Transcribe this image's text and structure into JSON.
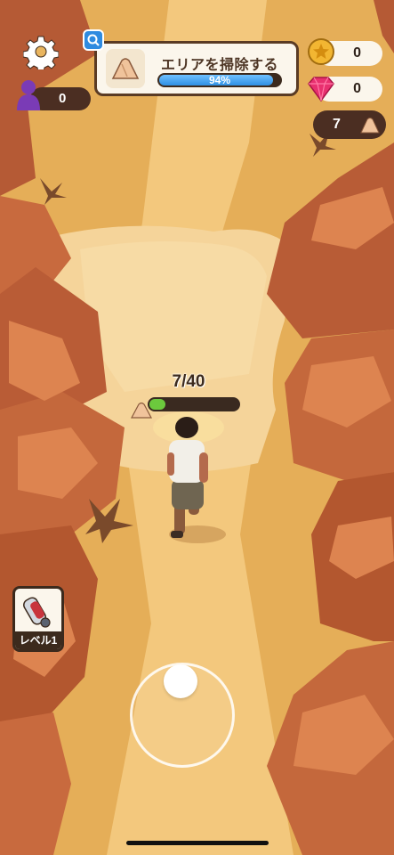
{
  "settings": {
    "icon": "gear-icon"
  },
  "quest": {
    "title": "エリアを掃除する",
    "progress_label": "94%",
    "progress": 0.94,
    "icon": "sand-pile-icon"
  },
  "players": {
    "count": "0",
    "icon": "player-silhouette-icon"
  },
  "currency": {
    "coins": "0",
    "gems": "0",
    "stones": "7"
  },
  "carry": {
    "label": "7/40",
    "current": 7,
    "max": 40
  },
  "level_card": {
    "label": "レベル1"
  },
  "colors": {
    "panel": "#fbf6ec",
    "dark": "#4b2e22",
    "progress_blue": "#2f90e3",
    "carry_green": "#6cc93d",
    "gem_pink": "#e8306f",
    "coin_gold": "#f2b632",
    "player_purple": "#7a3bb6"
  }
}
